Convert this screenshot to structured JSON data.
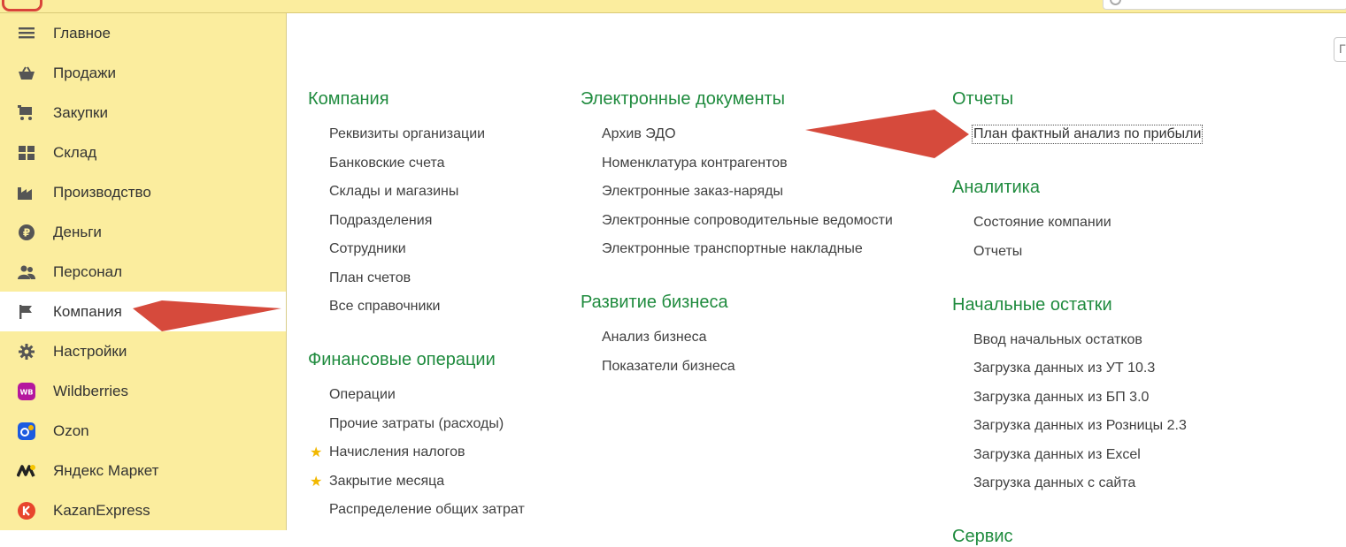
{
  "window": {
    "title_fragment": "_ _ _ (   )"
  },
  "sidebar": {
    "items": [
      {
        "label": "Главное",
        "icon": "menu-lines-icon",
        "active": false
      },
      {
        "label": "Продажи",
        "icon": "basket-icon",
        "active": false
      },
      {
        "label": "Закупки",
        "icon": "cart-icon",
        "active": false
      },
      {
        "label": "Склад",
        "icon": "warehouse-grid-icon",
        "active": false
      },
      {
        "label": "Производство",
        "icon": "factory-icon",
        "active": false
      },
      {
        "label": "Деньги",
        "icon": "ruble-coin-icon",
        "active": false
      },
      {
        "label": "Персонал",
        "icon": "people-icon",
        "active": false
      },
      {
        "label": "Компания",
        "icon": "flag-icon",
        "active": true
      },
      {
        "label": "Настройки",
        "icon": "gear-icon",
        "active": false
      },
      {
        "label": "Wildberries",
        "icon": "wildberries-logo-icon",
        "icon_text": "WB",
        "active": false
      },
      {
        "label": "Ozon",
        "icon": "ozon-logo-icon",
        "active": false
      },
      {
        "label": "Яндекс Маркет",
        "icon": "yandex-market-logo-icon",
        "active": false
      },
      {
        "label": "KazanExpress",
        "icon": "kazanexpress-logo-icon",
        "active": false
      }
    ]
  },
  "content": {
    "corner_button_label": "Г",
    "columns": [
      {
        "sections": [
          {
            "title": "Компания",
            "links": [
              {
                "label": "Реквизиты организации"
              },
              {
                "label": "Банковские счета"
              },
              {
                "label": "Склады и магазины"
              },
              {
                "label": "Подразделения"
              },
              {
                "label": "Сотрудники"
              },
              {
                "label": "План счетов"
              },
              {
                "label": "Все справочники"
              }
            ]
          },
          {
            "title": "Финансовые операции",
            "links": [
              {
                "label": "Операции"
              },
              {
                "label": "Прочие затраты (расходы)"
              },
              {
                "label": "Начисления налогов",
                "starred": true
              },
              {
                "label": "Закрытие месяца",
                "starred": true
              },
              {
                "label": "Распределение общих затрат"
              }
            ]
          }
        ]
      },
      {
        "sections": [
          {
            "title": "Электронные документы",
            "links": [
              {
                "label": "Архив ЭДО"
              },
              {
                "label": "Номенклатура контрагентов"
              },
              {
                "label": "Электронные заказ-наряды"
              },
              {
                "label": "Электронные сопроводительные ведомости"
              },
              {
                "label": "Электронные транспортные накладные"
              }
            ]
          },
          {
            "title": "Развитие бизнеса",
            "links": [
              {
                "label": "Анализ бизнеса"
              },
              {
                "label": "Показатели бизнеса"
              }
            ]
          }
        ]
      },
      {
        "sections": [
          {
            "title": "Отчеты",
            "links": [
              {
                "label": "План фактный анализ по прибыли",
                "focused": true
              }
            ]
          },
          {
            "title": "Аналитика",
            "links": [
              {
                "label": "Состояние компании"
              },
              {
                "label": "Отчеты"
              }
            ]
          },
          {
            "title": "Начальные остатки",
            "links": [
              {
                "label": "Ввод начальных остатков"
              },
              {
                "label": "Загрузка данных из УТ 10.3"
              },
              {
                "label": "Загрузка данных из БП 3.0"
              },
              {
                "label": "Загрузка данных из Розницы 2.3"
              },
              {
                "label": "Загрузка данных из Excel"
              },
              {
                "label": "Загрузка данных с сайта"
              }
            ]
          },
          {
            "title": "Сервис",
            "links": []
          }
        ]
      }
    ]
  },
  "colors": {
    "sidebar_bg": "#fbed9e",
    "section_title": "#1f8b3e",
    "annotation_arrow": "#d64a3c",
    "star": "#f2b800"
  }
}
